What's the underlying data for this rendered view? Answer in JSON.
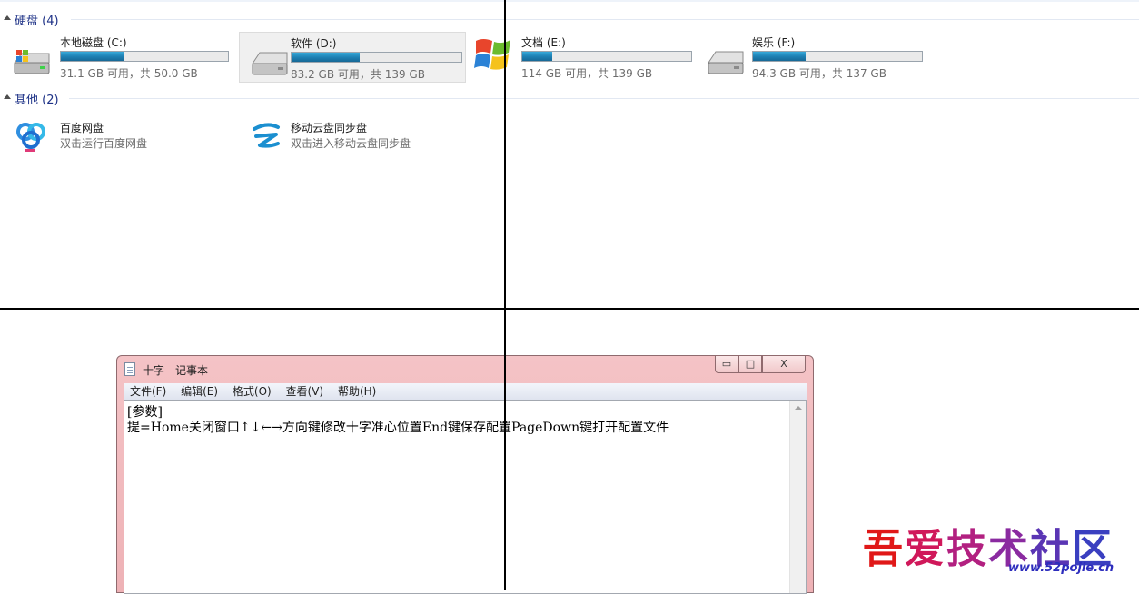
{
  "groups": {
    "hdd": {
      "title": "硬盘 (4)"
    },
    "other": {
      "title": "其他 (2)"
    }
  },
  "drives": [
    {
      "name": "本地磁盘 (C:)",
      "info": "31.1 GB 可用，共 50.0 GB",
      "used_fraction": 0.378,
      "icon": "windows-drive-icon"
    },
    {
      "name": "软件 (D:)",
      "info": "83.2 GB 可用，共 139 GB",
      "used_fraction": 0.401,
      "icon": "hard-drive-icon"
    },
    {
      "name": "文档 (E:)",
      "info": "114 GB 可用，共 139 GB",
      "used_fraction": 0.18,
      "icon": "windows-logo-icon"
    },
    {
      "name": "娱乐 (F:)",
      "info": "94.3 GB 可用，共 137 GB",
      "used_fraction": 0.312,
      "icon": "hard-drive-icon"
    }
  ],
  "others": [
    {
      "name": "百度网盘",
      "desc": "双击运行百度网盘",
      "icon": "baidu-netdisk-icon"
    },
    {
      "name": "移动云盘同步盘",
      "desc": "双击进入移动云盘同步盘",
      "icon": "mobile-cloud-icon"
    }
  ],
  "notepad": {
    "title": "十字 - 记事本",
    "menu": [
      "文件(F)",
      "编辑(E)",
      "格式(O)",
      "查看(V)",
      "帮助(H)"
    ],
    "lines": [
      "[参数]",
      "提=Home关闭窗口↑↓←→方向键修改十字准心位置End键保存配置PageDown键打开配置文件"
    ],
    "buttons": {
      "minimize": "▭",
      "maximize": "□",
      "close": "X"
    }
  },
  "watermark": {
    "chars": [
      "吾",
      "爱",
      "技",
      "术",
      "社",
      "区"
    ],
    "url": "www.52pojie.cn"
  },
  "colors": {
    "group_title": "#1e3287",
    "bar_fill": "#1d7fb2",
    "notepad_frame": "#eeb2b6",
    "crosshair": "#000000"
  }
}
